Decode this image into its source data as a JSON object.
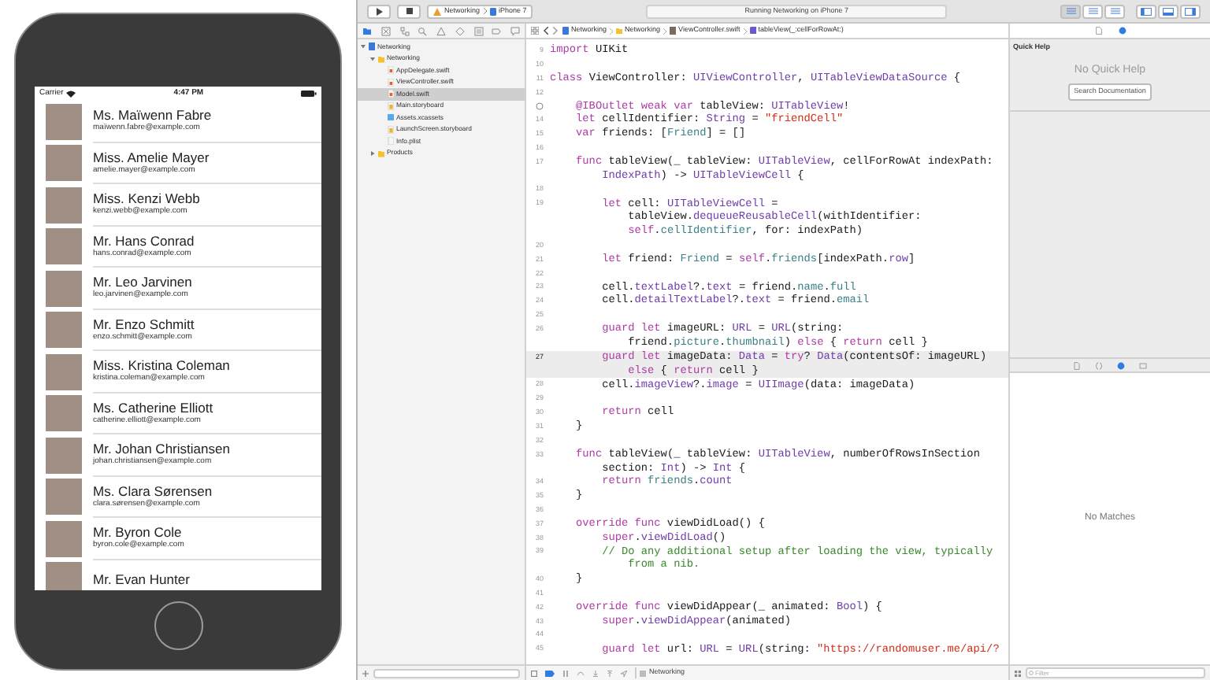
{
  "simulator": {
    "status_bar": {
      "carrier": "Carrier",
      "time": "4:47 PM"
    },
    "contacts": [
      {
        "name": "Ms. Maïwenn Fabre",
        "email": "maïwenn.fabre@example.com"
      },
      {
        "name": "Miss. Amelie Mayer",
        "email": "amelie.mayer@example.com"
      },
      {
        "name": "Miss. Kenzi Webb",
        "email": "kenzi.webb@example.com"
      },
      {
        "name": "Mr. Hans Conrad",
        "email": "hans.conrad@example.com"
      },
      {
        "name": "Mr. Leo Jarvinen",
        "email": "leo.jarvinen@example.com"
      },
      {
        "name": "Mr. Enzo Schmitt",
        "email": "enzo.schmitt@example.com"
      },
      {
        "name": "Miss. Kristina Coleman",
        "email": "kristina.coleman@example.com"
      },
      {
        "name": "Ms. Catherine Elliott",
        "email": "catherine.elliott@example.com"
      },
      {
        "name": "Mr. Johan Christiansen",
        "email": "johan.christiansen@example.com"
      },
      {
        "name": "Ms. Clara Sørensen",
        "email": "clara.sørensen@example.com"
      },
      {
        "name": "Mr. Byron Cole",
        "email": "byron.cole@example.com"
      },
      {
        "name": "Mr. Evan Hunter"
      }
    ]
  },
  "toolbar": {
    "scheme": "Networking",
    "device": "iPhone 7",
    "activity": "Running Networking on iPhone 7",
    "editor_modes": [
      {
        "selected": true
      },
      {
        "selected": false
      },
      {
        "selected": false
      }
    ],
    "panels": [
      {
        "on": true
      },
      {
        "on": true
      },
      {
        "on": true
      }
    ]
  },
  "navigator_tabs": [
    {
      "selected": true
    },
    {
      "selected": false
    },
    {
      "selected": false
    },
    {
      "selected": false
    },
    {
      "selected": false
    },
    {
      "selected": false
    },
    {
      "selected": false
    },
    {
      "selected": false
    },
    {
      "selected": false
    }
  ],
  "jump_bar": [
    "Networking",
    "Networking",
    "ViewController.swift",
    "tableView(_:cellForRowAt:)"
  ],
  "navigator": [
    {
      "name": "Networking",
      "kind": "project",
      "expanded": true,
      "selected": false,
      "children": [
        {
          "name": "Networking",
          "kind": "folder",
          "expanded": true,
          "selected": false,
          "children": [
            {
              "name": "AppDelegate.swift",
              "kind": "swift",
              "selected": false
            },
            {
              "name": "ViewController.swift",
              "kind": "swift",
              "selected": false
            },
            {
              "name": "Model.swift",
              "kind": "swift",
              "selected": true
            },
            {
              "name": "Main.storyboard",
              "kind": "storyboard",
              "selected": false
            },
            {
              "name": "Assets.xcassets",
              "kind": "assets",
              "selected": false
            },
            {
              "name": "LaunchScreen.storyboard",
              "kind": "storyboard",
              "selected": false
            },
            {
              "name": "Info.plist",
              "kind": "plist",
              "selected": false
            }
          ]
        },
        {
          "name": "Products",
          "kind": "folder",
          "expanded": false,
          "selected": false
        }
      ]
    }
  ],
  "editor": {
    "rows": [
      {
        "kind": "line",
        "number": "9",
        "highlighted": false,
        "tokens": [
          {
            "text": "import",
            "kind": "keyword"
          },
          {
            "text": " UIKit",
            "kind": "plain"
          }
        ]
      },
      {
        "kind": "line",
        "number": "10",
        "highlighted": false,
        "tokens": []
      },
      {
        "kind": "line",
        "number": "11",
        "highlighted": false,
        "tokens": [
          {
            "text": "class",
            "kind": "keyword"
          },
          {
            "text": " ViewController: ",
            "kind": "plain"
          },
          {
            "text": "UIViewController",
            "kind": "type"
          },
          {
            "text": ", ",
            "kind": "plain"
          },
          {
            "text": "UITableViewDataSource",
            "kind": "type"
          },
          {
            "text": " {",
            "kind": "plain"
          }
        ]
      },
      {
        "kind": "line",
        "number": "12",
        "highlighted": false,
        "tokens": []
      },
      {
        "kind": "outlet",
        "highlighted": false,
        "tokens": [
          {
            "text": "    @IBOutlet weak var",
            "kind": "keyword"
          },
          {
            "text": " tableView: ",
            "kind": "plain"
          },
          {
            "text": "UITableView",
            "kind": "type"
          },
          {
            "text": "!",
            "kind": "plain"
          }
        ]
      },
      {
        "kind": "line",
        "number": "14",
        "highlighted": false,
        "tokens": [
          {
            "text": "    let",
            "kind": "keyword"
          },
          {
            "text": " cellIdentifier: ",
            "kind": "plain"
          },
          {
            "text": "String",
            "kind": "type"
          },
          {
            "text": " = ",
            "kind": "plain"
          },
          {
            "text": "\"friendCell\"",
            "kind": "string"
          }
        ]
      },
      {
        "kind": "line",
        "number": "15",
        "highlighted": false,
        "tokens": [
          {
            "text": "    var",
            "kind": "keyword"
          },
          {
            "text": " friends: [",
            "kind": "plain"
          },
          {
            "text": "Friend",
            "kind": "project"
          },
          {
            "text": "] = []",
            "kind": "plain"
          }
        ]
      },
      {
        "kind": "line",
        "number": "16",
        "highlighted": false,
        "tokens": []
      },
      {
        "kind": "line",
        "number": "17",
        "highlighted": false,
        "tokens": [
          {
            "text": "    func",
            "kind": "keyword"
          },
          {
            "text": " tableView(_ tableView: ",
            "kind": "plain"
          },
          {
            "text": "UITableView",
            "kind": "type"
          },
          {
            "text": ", cellForRowAt indexPath:",
            "kind": "plain"
          }
        ]
      },
      {
        "kind": "wrap",
        "highlighted": false,
        "tokens": [
          {
            "text": "        IndexPath",
            "kind": "type"
          },
          {
            "text": ") -> ",
            "kind": "plain"
          },
          {
            "text": "UITableViewCell",
            "kind": "type"
          },
          {
            "text": " {",
            "kind": "plain"
          }
        ]
      },
      {
        "kind": "line",
        "number": "18",
        "highlighted": false,
        "tokens": []
      },
      {
        "kind": "line",
        "number": "19",
        "highlighted": false,
        "tokens": [
          {
            "text": "        let",
            "kind": "keyword"
          },
          {
            "text": " cell: ",
            "kind": "plain"
          },
          {
            "text": "UITableViewCell",
            "kind": "type"
          },
          {
            "text": " =",
            "kind": "plain"
          }
        ]
      },
      {
        "kind": "wrap",
        "highlighted": false,
        "tokens": [
          {
            "text": "            tableView.",
            "kind": "plain"
          },
          {
            "text": "dequeueReusableCell",
            "kind": "type"
          },
          {
            "text": "(withIdentifier:",
            "kind": "plain"
          }
        ]
      },
      {
        "kind": "wrap",
        "highlighted": false,
        "tokens": [
          {
            "text": "            self",
            "kind": "keyword"
          },
          {
            "text": ".",
            "kind": "plain"
          },
          {
            "text": "cellIdentifier",
            "kind": "project"
          },
          {
            "text": ", for: indexPath)",
            "kind": "plain"
          }
        ]
      },
      {
        "kind": "line",
        "number": "20",
        "highlighted": false,
        "tokens": []
      },
      {
        "kind": "line",
        "number": "21",
        "highlighted": false,
        "tokens": [
          {
            "text": "        let",
            "kind": "keyword"
          },
          {
            "text": " friend: ",
            "kind": "plain"
          },
          {
            "text": "Friend",
            "kind": "project"
          },
          {
            "text": " = ",
            "kind": "plain"
          },
          {
            "text": "self",
            "kind": "keyword"
          },
          {
            "text": ".",
            "kind": "plain"
          },
          {
            "text": "friends",
            "kind": "project"
          },
          {
            "text": "[indexPath.",
            "kind": "plain"
          },
          {
            "text": "row",
            "kind": "type"
          },
          {
            "text": "]",
            "kind": "plain"
          }
        ]
      },
      {
        "kind": "line",
        "number": "22",
        "highlighted": false,
        "tokens": []
      },
      {
        "kind": "line",
        "number": "23",
        "highlighted": false,
        "tokens": [
          {
            "text": "        cell.",
            "kind": "plain"
          },
          {
            "text": "textLabel",
            "kind": "type"
          },
          {
            "text": "?.",
            "kind": "plain"
          },
          {
            "text": "text",
            "kind": "type"
          },
          {
            "text": " = friend.",
            "kind": "plain"
          },
          {
            "text": "name",
            "kind": "project"
          },
          {
            "text": ".",
            "kind": "plain"
          },
          {
            "text": "full",
            "kind": "project"
          }
        ]
      },
      {
        "kind": "line",
        "number": "24",
        "highlighted": false,
        "tokens": [
          {
            "text": "        cell.",
            "kind": "plain"
          },
          {
            "text": "detailTextLabel",
            "kind": "type"
          },
          {
            "text": "?.",
            "kind": "plain"
          },
          {
            "text": "text",
            "kind": "type"
          },
          {
            "text": " = friend.",
            "kind": "plain"
          },
          {
            "text": "email",
            "kind": "project"
          }
        ]
      },
      {
        "kind": "line",
        "number": "25",
        "highlighted": false,
        "tokens": []
      },
      {
        "kind": "line",
        "number": "26",
        "highlighted": false,
        "tokens": [
          {
            "text": "        guard let",
            "kind": "keyword"
          },
          {
            "text": " imageURL: ",
            "kind": "plain"
          },
          {
            "text": "URL",
            "kind": "type"
          },
          {
            "text": " = ",
            "kind": "plain"
          },
          {
            "text": "URL",
            "kind": "type"
          },
          {
            "text": "(string:",
            "kind": "plain"
          }
        ]
      },
      {
        "kind": "wrap",
        "highlighted": false,
        "tokens": [
          {
            "text": "            friend.",
            "kind": "plain"
          },
          {
            "text": "picture",
            "kind": "project"
          },
          {
            "text": ".",
            "kind": "plain"
          },
          {
            "text": "thumbnail",
            "kind": "project"
          },
          {
            "text": ") ",
            "kind": "plain"
          },
          {
            "text": "else",
            "kind": "keyword"
          },
          {
            "text": " { ",
            "kind": "plain"
          },
          {
            "text": "return",
            "kind": "keyword"
          },
          {
            "text": " cell }",
            "kind": "plain"
          }
        ]
      },
      {
        "kind": "line",
        "number": "27",
        "highlighted": true,
        "tokens": [
          {
            "text": "        guard let",
            "kind": "keyword"
          },
          {
            "text": " imageData: ",
            "kind": "plain"
          },
          {
            "text": "Data",
            "kind": "type"
          },
          {
            "text": " = ",
            "kind": "plain"
          },
          {
            "text": "try",
            "kind": "keyword"
          },
          {
            "text": "? ",
            "kind": "plain"
          },
          {
            "text": "Data",
            "kind": "type"
          },
          {
            "text": "(contentsOf: imageURL)",
            "kind": "plain"
          }
        ]
      },
      {
        "kind": "wrap",
        "highlighted": true,
        "tokens": [
          {
            "text": "            else",
            "kind": "keyword"
          },
          {
            "text": " { ",
            "kind": "plain"
          },
          {
            "text": "return",
            "kind": "keyword"
          },
          {
            "text": " cell }",
            "kind": "plain"
          }
        ]
      },
      {
        "kind": "line",
        "number": "28",
        "highlighted": false,
        "tokens": [
          {
            "text": "        cell.",
            "kind": "plain"
          },
          {
            "text": "imageView",
            "kind": "type"
          },
          {
            "text": "?.",
            "kind": "plain"
          },
          {
            "text": "image",
            "kind": "type"
          },
          {
            "text": " = ",
            "kind": "plain"
          },
          {
            "text": "UIImage",
            "kind": "type"
          },
          {
            "text": "(data: imageData)",
            "kind": "plain"
          }
        ]
      },
      {
        "kind": "line",
        "number": "29",
        "highlighted": false,
        "tokens": []
      },
      {
        "kind": "line",
        "number": "30",
        "highlighted": false,
        "tokens": [
          {
            "text": "        return",
            "kind": "keyword"
          },
          {
            "text": " cell",
            "kind": "plain"
          }
        ]
      },
      {
        "kind": "line",
        "number": "31",
        "highlighted": false,
        "tokens": [
          {
            "text": "    }",
            "kind": "plain"
          }
        ]
      },
      {
        "kind": "line",
        "number": "32",
        "highlighted": false,
        "tokens": []
      },
      {
        "kind": "line",
        "number": "33",
        "highlighted": false,
        "tokens": [
          {
            "text": "    func",
            "kind": "keyword"
          },
          {
            "text": " tableView(_ tableView: ",
            "kind": "plain"
          },
          {
            "text": "UITableView",
            "kind": "type"
          },
          {
            "text": ", numberOfRowsInSection",
            "kind": "plain"
          }
        ]
      },
      {
        "kind": "wrap",
        "highlighted": false,
        "tokens": [
          {
            "text": "        section: ",
            "kind": "plain"
          },
          {
            "text": "Int",
            "kind": "type"
          },
          {
            "text": ") -> ",
            "kind": "plain"
          },
          {
            "text": "Int",
            "kind": "type"
          },
          {
            "text": " {",
            "kind": "plain"
          }
        ]
      },
      {
        "kind": "line",
        "number": "34",
        "highlighted": false,
        "tokens": [
          {
            "text": "        return ",
            "kind": "keyword"
          },
          {
            "text": "friends",
            "kind": "project"
          },
          {
            "text": ".",
            "kind": "plain"
          },
          {
            "text": "count",
            "kind": "type"
          }
        ]
      },
      {
        "kind": "line",
        "number": "35",
        "highlighted": false,
        "tokens": [
          {
            "text": "    }",
            "kind": "plain"
          }
        ]
      },
      {
        "kind": "line",
        "number": "36",
        "highlighted": false,
        "tokens": []
      },
      {
        "kind": "line",
        "number": "37",
        "highlighted": false,
        "tokens": [
          {
            "text": "    override func",
            "kind": "keyword"
          },
          {
            "text": " viewDidLoad() {",
            "kind": "plain"
          }
        ]
      },
      {
        "kind": "line",
        "number": "38",
        "highlighted": false,
        "tokens": [
          {
            "text": "        super",
            "kind": "keyword"
          },
          {
            "text": ".",
            "kind": "plain"
          },
          {
            "text": "viewDidLoad",
            "kind": "type"
          },
          {
            "text": "()",
            "kind": "plain"
          }
        ]
      },
      {
        "kind": "line",
        "number": "39",
        "highlighted": false,
        "tokens": [
          {
            "text": "        // Do any additional setup after loading the view, typically",
            "kind": "comment"
          }
        ]
      },
      {
        "kind": "wrap",
        "highlighted": false,
        "tokens": [
          {
            "text": "            from a nib.",
            "kind": "comment"
          }
        ]
      },
      {
        "kind": "line",
        "number": "40",
        "highlighted": false,
        "tokens": [
          {
            "text": "    }",
            "kind": "plain"
          }
        ]
      },
      {
        "kind": "line",
        "number": "41",
        "highlighted": false,
        "tokens": []
      },
      {
        "kind": "line",
        "number": "42",
        "highlighted": false,
        "tokens": [
          {
            "text": "    override func",
            "kind": "keyword"
          },
          {
            "text": " viewDidAppear(_ animated: ",
            "kind": "plain"
          },
          {
            "text": "Bool",
            "kind": "type"
          },
          {
            "text": ") {",
            "kind": "plain"
          }
        ]
      },
      {
        "kind": "line",
        "number": "43",
        "highlighted": false,
        "tokens": [
          {
            "text": "        super",
            "kind": "keyword"
          },
          {
            "text": ".",
            "kind": "plain"
          },
          {
            "text": "viewDidAppear",
            "kind": "type"
          },
          {
            "text": "(animated)",
            "kind": "plain"
          }
        ]
      },
      {
        "kind": "line",
        "number": "44",
        "highlighted": false,
        "tokens": []
      },
      {
        "kind": "line",
        "number": "45",
        "highlighted": false,
        "tokens": [
          {
            "text": "        guard let",
            "kind": "keyword"
          },
          {
            "text": " url: ",
            "kind": "plain"
          },
          {
            "text": "URL",
            "kind": "type"
          },
          {
            "text": " = ",
            "kind": "plain"
          },
          {
            "text": "URL",
            "kind": "type"
          },
          {
            "text": "(string: ",
            "kind": "plain"
          },
          {
            "text": "\"https://randomuser.me/api/?",
            "kind": "string"
          }
        ]
      }
    ]
  },
  "debug_bar": {
    "target": "Networking"
  },
  "inspector": {
    "tabs": [
      {
        "selected": false
      },
      {
        "selected": true
      }
    ],
    "title": "Quick Help",
    "message": "No Quick Help",
    "button": "Search Documentation",
    "library_tabs": [
      {
        "selected": false
      },
      {
        "selected": false
      },
      {
        "selected": true
      },
      {
        "selected": false
      }
    ],
    "library_message": "No Matches",
    "filter_placeholder": "Filter"
  }
}
